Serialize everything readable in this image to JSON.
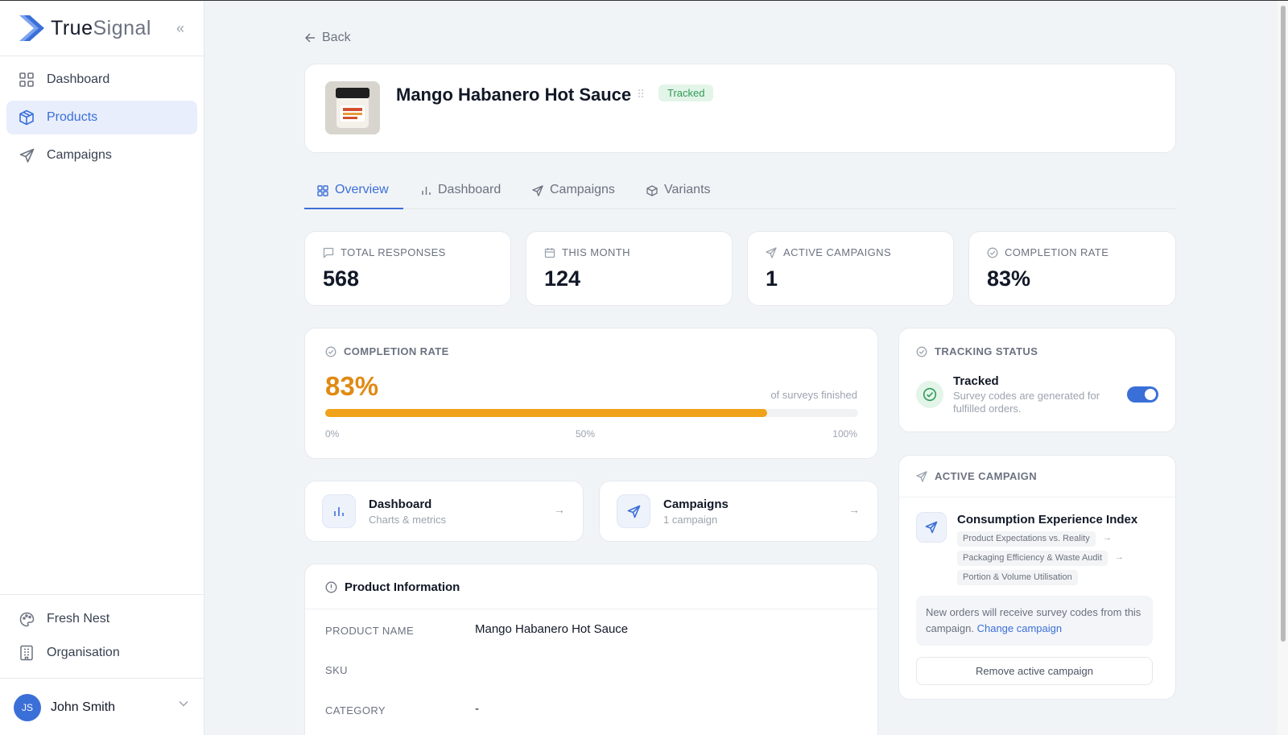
{
  "brand": {
    "name_bold": "True",
    "name_light": "Signal"
  },
  "sidebar": {
    "items": [
      {
        "label": "Dashboard",
        "icon": "grid-icon"
      },
      {
        "label": "Products",
        "icon": "box-icon",
        "active": true
      },
      {
        "label": "Campaigns",
        "icon": "send-icon"
      }
    ],
    "bottom_items": [
      {
        "label": "Fresh Nest",
        "icon": "palette-icon"
      },
      {
        "label": "Organisation",
        "icon": "building-icon"
      }
    ],
    "user": {
      "initials": "JS",
      "name": "John Smith"
    }
  },
  "header": {
    "back_label": "Back",
    "product_title": "Mango Habanero Hot Sauce",
    "status_badge": "Tracked"
  },
  "tabs": [
    {
      "label": "Overview",
      "active": true
    },
    {
      "label": "Dashboard"
    },
    {
      "label": "Campaigns"
    },
    {
      "label": "Variants"
    }
  ],
  "stats": [
    {
      "label": "TOTAL RESPONSES",
      "value": "568",
      "icon": "message-icon"
    },
    {
      "label": "THIS MONTH",
      "value": "124",
      "icon": "calendar-icon"
    },
    {
      "label": "ACTIVE CAMPAIGNS",
      "value": "1",
      "icon": "send-icon"
    },
    {
      "label": "COMPLETION RATE",
      "value": "83%",
      "icon": "check-circle-icon"
    }
  ],
  "completion": {
    "label": "COMPLETION RATE",
    "value": "83%",
    "fraction": 0.83,
    "caption": "of surveys finished",
    "ticks": [
      "0%",
      "50%",
      "100%"
    ]
  },
  "links": [
    {
      "title": "Dashboard",
      "subtitle": "Charts & metrics",
      "icon": "bar-chart-icon"
    },
    {
      "title": "Campaigns",
      "subtitle": "1 campaign",
      "icon": "send-icon"
    }
  ],
  "product_info": {
    "heading": "Product Information",
    "rows": [
      {
        "label": "PRODUCT NAME",
        "value": "Mango Habanero Hot Sauce"
      },
      {
        "label": "SKU",
        "value": ""
      },
      {
        "label": "CATEGORY",
        "value": "-"
      }
    ]
  },
  "tracking": {
    "label": "TRACKING STATUS",
    "title": "Tracked",
    "description": "Survey codes are generated for fulfilled orders.",
    "enabled": true
  },
  "active_campaign": {
    "label": "ACTIVE CAMPAIGN",
    "title": "Consumption Experience Index",
    "chips": [
      "Product Expectations vs. Reality",
      "Packaging Efficiency & Waste Audit",
      "Portion & Volume Utilisation"
    ],
    "note_text": "New orders will receive survey codes from this campaign. ",
    "note_link": "Change campaign",
    "remove_label": "Remove active campaign"
  },
  "colors": {
    "accent": "#3b6fd8",
    "success": "#2f9a57",
    "warning": "#f0a21a"
  }
}
